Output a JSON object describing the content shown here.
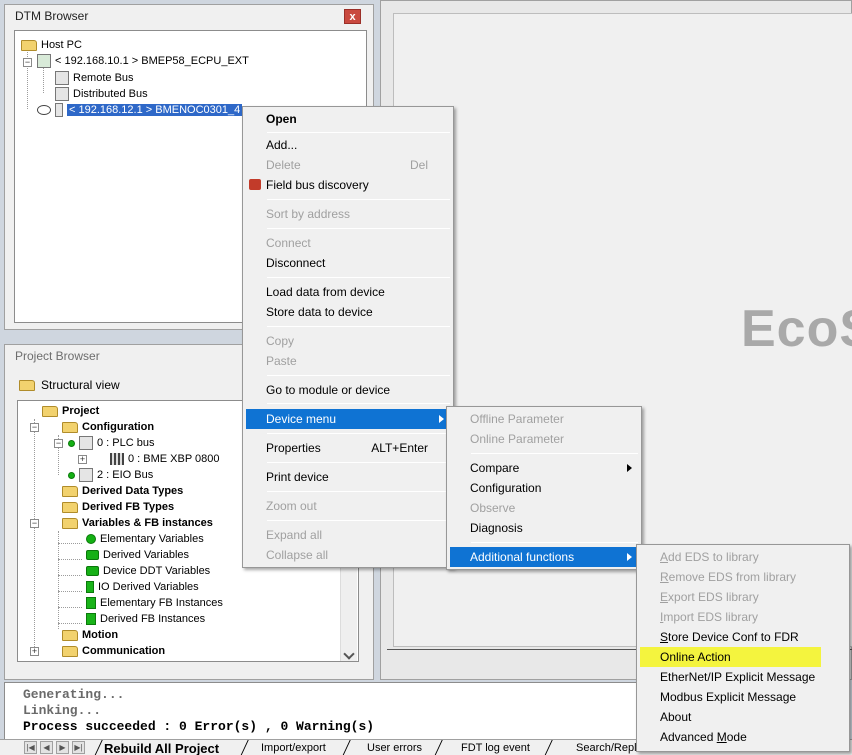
{
  "dtm_browser": {
    "title": "DTM Browser",
    "close_label": "x",
    "nodes": {
      "host": "Host PC",
      "cpu": "< 192.168.10.1 > BMEP58_ECPU_EXT",
      "remote_bus": "Remote Bus",
      "distributed_bus": "Distributed Bus",
      "noc": "< 192.168.12.1 > BMENOC0301_4"
    }
  },
  "project_browser": {
    "title": "Project Browser",
    "view_label": "Structural view",
    "nodes": {
      "project": "Project",
      "configuration": "Configuration",
      "plc_bus": "0 : PLC bus",
      "bme_xbp": "0 : BME XBP 0800",
      "eio_bus": "2 : EIO Bus",
      "derived_data_types": "Derived Data Types",
      "derived_fb_types": "Derived FB Types",
      "variables_fb": "Variables & FB instances",
      "elementary_variables": "Elementary Variables",
      "derived_variables": "Derived Variables",
      "device_ddt_variables": "Device DDT Variables",
      "io_derived_variables": "IO Derived Variables",
      "elementary_fb_instances": "Elementary FB Instances",
      "derived_fb_instances": "Derived FB Instances",
      "motion": "Motion",
      "communication": "Communication"
    }
  },
  "splash": {
    "text": "EcoS"
  },
  "context_menu": {
    "open": "Open",
    "add": "Add...",
    "delete": "Delete",
    "delete_shortcut": "Del",
    "field_bus_discovery": "Field bus discovery",
    "sort_by_address": "Sort  by address",
    "connect": "Connect",
    "disconnect": "Disconnect",
    "load_data": "Load data from device",
    "store_data": "Store data to device",
    "copy": "Copy",
    "paste": "Paste",
    "go_to_module": "Go to module or device",
    "device_menu": "Device menu",
    "properties": "Properties",
    "properties_shortcut": "ALT+Enter",
    "print_device": "Print device",
    "zoom_out": "Zoom out",
    "expand_all": "Expand all",
    "collapse_all": "Collapse all"
  },
  "device_submenu": {
    "offline_parameter": "Offline Parameter",
    "online_parameter": "Online Parameter",
    "compare": "Compare",
    "configuration": "Configuration",
    "observe": "Observe",
    "diagnosis": "Diagnosis",
    "additional_functions": "Additional functions"
  },
  "additional_submenu": {
    "add_eds_first": "A",
    "add_eds_rest": "dd EDS to library",
    "remove_eds_first": "R",
    "remove_eds_rest": "emove EDS from library",
    "export_eds_first": "E",
    "export_eds_rest": "xport EDS library",
    "import_eds_first": "I",
    "import_eds_rest": "mport EDS library",
    "store_conf_first": "S",
    "store_conf_rest": "tore Device Conf to FDR",
    "online_action": "Online Action",
    "ethernet_ip": "EtherNet/IP Explicit Message",
    "modbus": "Modbus Explicit Message",
    "about": "About",
    "advanced_mode_pre": "Advanced ",
    "advanced_mode_ul": "M",
    "advanced_mode_post": "ode",
    "highlight_color": "#f4f43e"
  },
  "output": {
    "line1": "Generating...",
    "line2": "Linking...",
    "line3": "Process succeeded  : 0 Error(s) , 0 Warning(s)"
  },
  "bottom_tabs": {
    "rebuild": "Rebuild All Project",
    "import_export": "Import/export",
    "user_errors": "User errors",
    "fdt_log": "FDT log event",
    "search_replace": "Search/Replace"
  }
}
